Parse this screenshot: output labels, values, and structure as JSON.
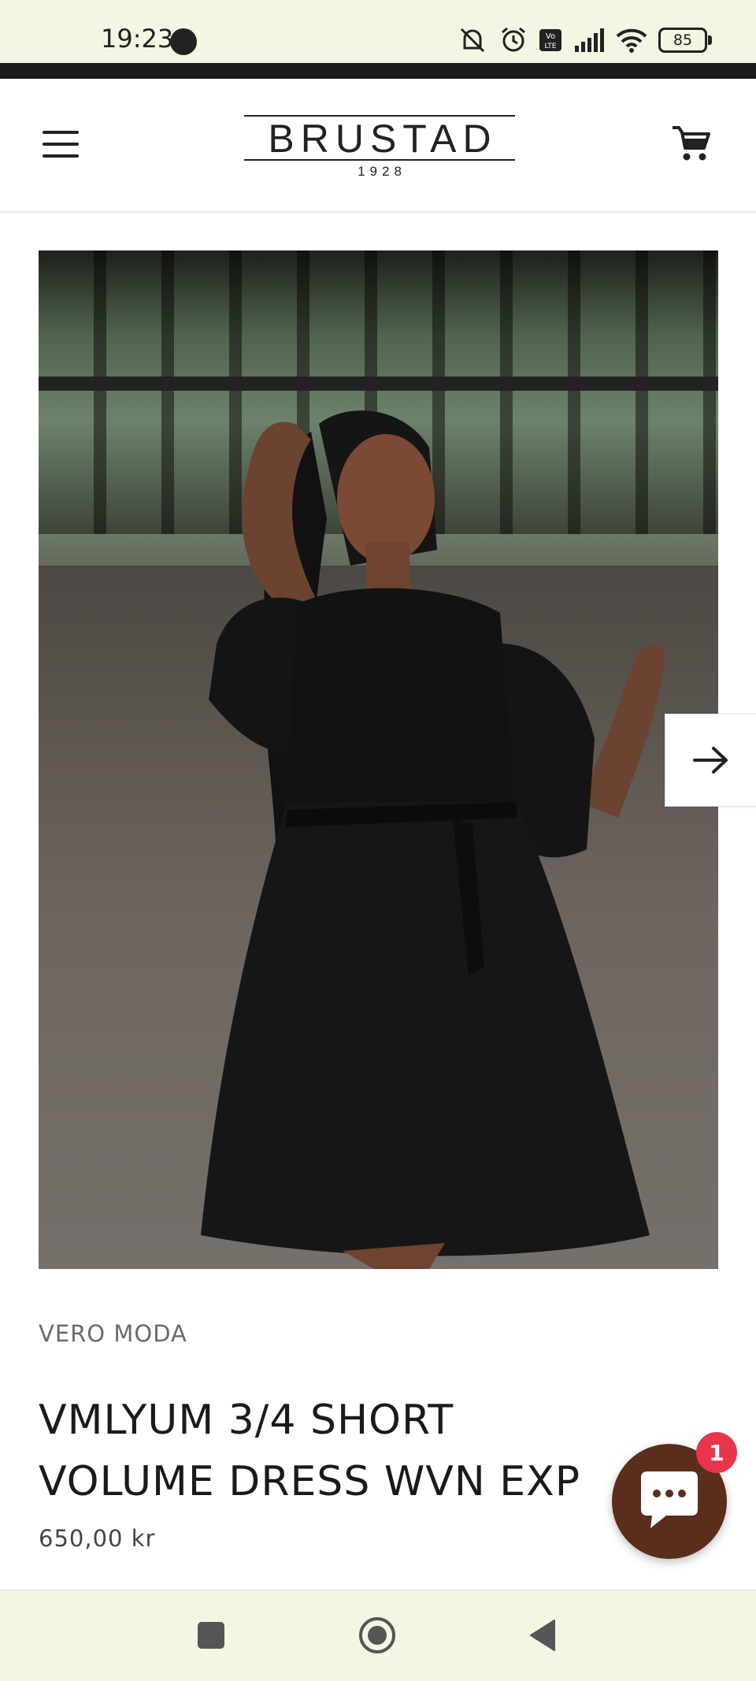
{
  "status_bar": {
    "time": "19:23",
    "battery": "85",
    "icons": [
      "moon-icon",
      "mute-icon",
      "alarm-icon",
      "volte-icon",
      "signal-icon",
      "wifi-icon",
      "battery-icon"
    ]
  },
  "header": {
    "logo_name": "BRUSTAD",
    "logo_year": "1928",
    "menu_icon": "hamburger-menu-icon",
    "cart_icon": "shopping-cart-icon"
  },
  "product": {
    "image_alt": "Model wearing black volume dress",
    "vendor": "VERO MODA",
    "title": "VMLYUM 3/4 SHORT VOLUME DRESS WVN EXP",
    "price": "650,00 kr"
  },
  "gallery": {
    "next_icon": "arrow-right-icon"
  },
  "chat": {
    "icon": "chat-bubble-icon",
    "badge_count": "1",
    "brand_color": "#5b2d1c",
    "badge_color": "#e8354b"
  },
  "navbar": {
    "buttons": [
      "recent-apps-button",
      "home-button",
      "back-button"
    ]
  }
}
